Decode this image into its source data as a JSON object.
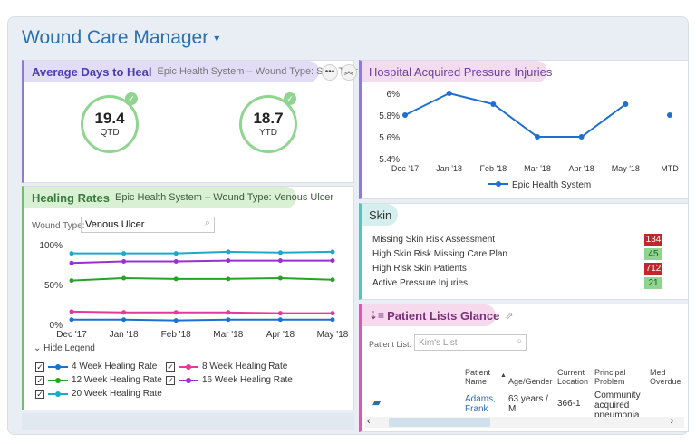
{
  "app": {
    "title": "Wound Care Manager",
    "caret": "▾"
  },
  "avg": {
    "title": "Average Days to Heal",
    "subtitle": "Epic Health System – Wound Type: Skin Tear",
    "metrics": [
      {
        "value": "19.4",
        "label": "QTD"
      },
      {
        "value": "18.7",
        "label": "YTD"
      }
    ],
    "more_icon": "ellipsis-icon",
    "collapse_icon": "chevron-up-icon"
  },
  "heal": {
    "title": "Healing Rates",
    "subtitle": "Epic Health System – Wound Type: Venous Ulcer",
    "wound_type_label": "Wound Type:",
    "wound_type_value": "Venous Ulcer",
    "hide_legend": "⌄ Hide Legend",
    "legend": [
      {
        "name": "4 Week Healing Rate",
        "color": "#1f6fd0"
      },
      {
        "name": "8 Week Healing Rate",
        "color": "#e5399a"
      },
      {
        "name": "12 Week Healing Rate",
        "color": "#2aa02a"
      },
      {
        "name": "16 Week Healing Rate",
        "color": "#9b2fd6"
      },
      {
        "name": "20 Week Healing Rate",
        "color": "#1fa8c9"
      }
    ]
  },
  "hapi": {
    "title": "Hospital Acquired Pressure Injuries",
    "legend": "Epic Health System"
  },
  "skin": {
    "title": "Skin",
    "rows": [
      {
        "label": "Missing Skin Risk Assessment",
        "value": "134",
        "bg": "#c0262c",
        "fg": "#ffffff"
      },
      {
        "label": "High Skin Risk Missing Care Plan",
        "value": "45",
        "bg": "#8fd48f",
        "fg": "#1b5e1b"
      },
      {
        "label": "High Risk Skin Patients",
        "value": "712",
        "bg": "#c0262c",
        "fg": "#ffffff"
      },
      {
        "label": "Active Pressure Injuries",
        "value": "21",
        "bg": "#8fd48f",
        "fg": "#1b5e1b"
      }
    ]
  },
  "plg": {
    "title": "Patient Lists Glance",
    "list_label": "Patient List:",
    "list_value": "Kim's List",
    "columns": [
      "Patient Name",
      "Age/Gender",
      "Current Location",
      "Principal Problem",
      "Med Overdue"
    ],
    "row": {
      "name": "Adams, Frank",
      "age": "63 years / M",
      "location": "366-1",
      "problem": "Community acquired pneumonia"
    }
  },
  "chart_data": [
    {
      "type": "line",
      "title": "Hospital Acquired Pressure Injuries",
      "categories": [
        "Dec '17",
        "Jan '18",
        "Feb '18",
        "Mar '18",
        "Apr '18",
        "May '18",
        "MTD"
      ],
      "series": [
        {
          "name": "Epic Health System",
          "values": [
            5.8,
            6.0,
            5.9,
            5.6,
            5.6,
            5.9,
            5.8
          ]
        }
      ],
      "yticks": [
        "6%",
        "5.8%",
        "5.6%",
        "5.4%"
      ],
      "ylim": [
        5.4,
        6.0
      ]
    },
    {
      "type": "line",
      "title": "Healing Rates",
      "categories": [
        "Dec '17",
        "Jan '18",
        "Feb '18",
        "Mar '18",
        "Apr '18",
        "May '18"
      ],
      "yticks": [
        "100%",
        "50%",
        "0%"
      ],
      "ylim": [
        0,
        100
      ],
      "series": [
        {
          "name": "4 Week Healing Rate",
          "values": [
            6,
            6,
            5,
            6,
            6,
            6
          ]
        },
        {
          "name": "8 Week Healing Rate",
          "values": [
            16,
            15,
            15,
            15,
            14,
            14
          ]
        },
        {
          "name": "12 Week Healing Rate",
          "values": [
            55,
            58,
            57,
            57,
            58,
            56
          ]
        },
        {
          "name": "16 Week Healing Rate",
          "values": [
            77,
            79,
            79,
            80,
            80,
            80
          ]
        },
        {
          "name": "20 Week Healing Rate",
          "values": [
            89,
            89,
            89,
            91,
            90,
            91
          ]
        }
      ]
    }
  ]
}
